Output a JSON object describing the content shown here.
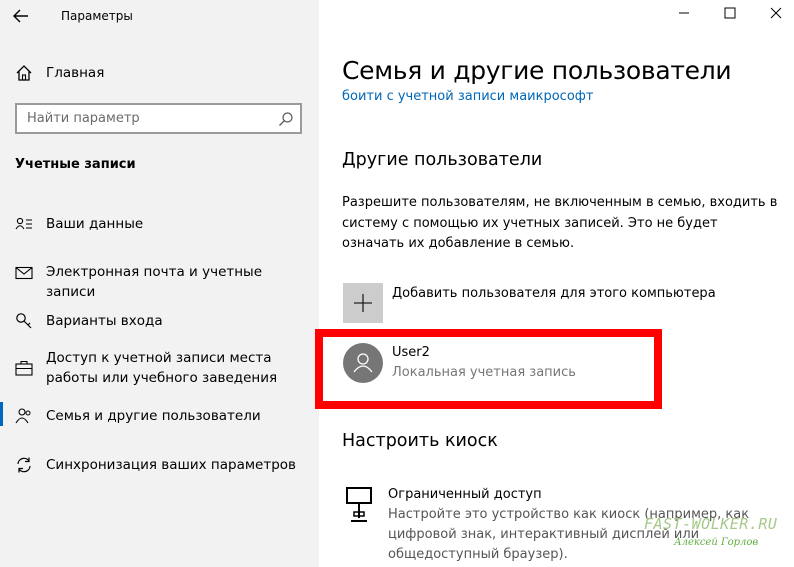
{
  "window": {
    "title": "Параметры",
    "minimize": "—",
    "maximize": "☐",
    "close": "✕"
  },
  "sidebar": {
    "home_label": "Главная",
    "search_placeholder": "Найти параметр",
    "section_title": "Учетные записи",
    "items": [
      {
        "label": "Ваши данные",
        "icon": "person-card-icon"
      },
      {
        "label": "Электронная почта и учетные записи",
        "icon": "mail-icon"
      },
      {
        "label": "Варианты входа",
        "icon": "key-icon"
      },
      {
        "label": "Доступ к учетной записи места работы или учебного заведения",
        "icon": "briefcase-icon"
      },
      {
        "label": "Семья и другие пользователи",
        "icon": "people-icon",
        "active": true
      },
      {
        "label": "Синхронизация ваших параметров",
        "icon": "sync-icon"
      }
    ]
  },
  "main": {
    "title": "Семья и другие пользователи",
    "signin_link": "боити с учетной записи маикрософт",
    "other_users": {
      "heading": "Другие пользователи",
      "description": "Разрешите пользователям, не включенным в семью, входить в систему с помощью их учетных записей. Это не будет означать их добавление в семью.",
      "add_label": "Добавить пользователя для этого компьютера",
      "user": {
        "name": "User2",
        "type": "Локальная учетная запись"
      }
    },
    "kiosk": {
      "heading": "Настроить киоск",
      "title": "Ограниченный доступ",
      "description": "Настройте это устройство как киоск (например, как цифровой знак, интерактивный дисплей или общедоступный браузер)."
    }
  },
  "watermark": {
    "site": "FAST-WOLKER.RU",
    "author": "Алексей Горлов"
  },
  "colors": {
    "accent": "#0067c0",
    "link": "#0067b8",
    "highlight_box": "#ff0000",
    "nav_bg": "#f2f2f2"
  }
}
